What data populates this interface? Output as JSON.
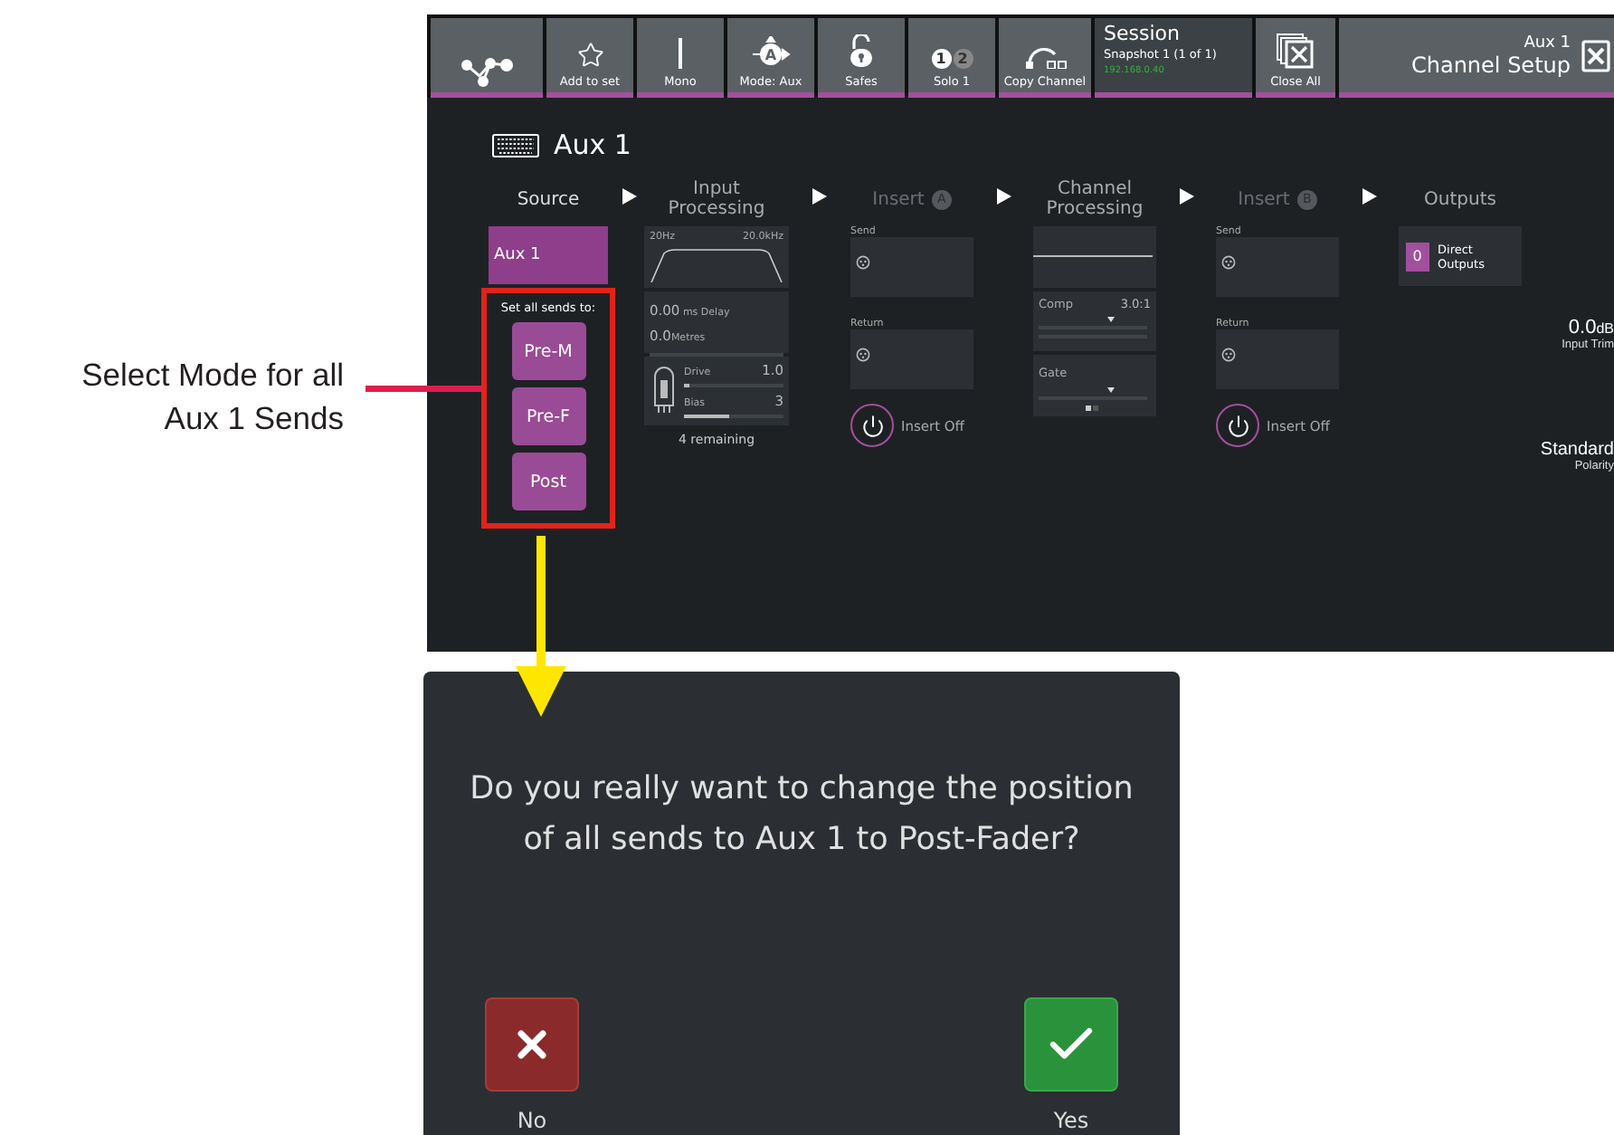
{
  "annotation": {
    "text": "Select Mode for all Aux 1 Sends"
  },
  "toolbar": {
    "buttons": [
      {
        "kind": "routing"
      },
      {
        "kind": "star",
        "label": "Add to set"
      },
      {
        "kind": "mono",
        "label": "Mono"
      },
      {
        "kind": "mode",
        "label": "Mode: Aux",
        "icon_text": "A"
      },
      {
        "kind": "lock",
        "label": "Safes"
      },
      {
        "kind": "solo",
        "label": "Solo 1",
        "solo_marks": [
          {
            "text": "1",
            "on": true
          },
          {
            "text": "2",
            "on": false
          }
        ]
      },
      {
        "kind": "copy",
        "label": "Copy Channel"
      }
    ],
    "session": {
      "title": "Session",
      "snapshot": "Snapshot 1 (1 of 1)",
      "address": "192.168.0.40"
    },
    "close_all": {
      "label": "Close All"
    },
    "header": {
      "subtitle": "Aux 1",
      "title": "Channel Setup"
    }
  },
  "channel": {
    "name": "Aux 1"
  },
  "stages": [
    {
      "kind": "source",
      "title": "Source",
      "source": "Aux 1",
      "sends_prompt": "Set all sends to:",
      "send_modes": [
        "Pre-M",
        "Pre-F",
        "Post"
      ]
    },
    {
      "kind": "input",
      "title": "Input Processing",
      "filter_low": "20Hz",
      "filter_high": "20.0kHz",
      "delay_value": "0.00",
      "delay_unit": "ms Delay",
      "distance_value": "0.0",
      "distance_unit": "Metres",
      "drive": {
        "label": "Drive",
        "value": "1.0",
        "level": 0.05
      },
      "bias": {
        "label": "Bias",
        "value": "3",
        "level": 0.45
      },
      "remaining": "4 remaining"
    },
    {
      "kind": "insert",
      "title": "Insert",
      "badge": "A",
      "enabled": false,
      "send_label": "Send",
      "return_label": "Return",
      "status": "Insert Off"
    },
    {
      "kind": "channel",
      "title": "Channel Processing",
      "comp_label": "Comp",
      "comp_value": "3.0:1",
      "gate_label": "Gate"
    },
    {
      "kind": "insert",
      "title": "Insert",
      "badge": "B",
      "enabled": false,
      "send_label": "Send",
      "return_label": "Return",
      "status": "Insert Off"
    },
    {
      "kind": "outputs",
      "title": "Outputs",
      "count": "0",
      "label": "Direct Outputs"
    }
  ],
  "trim": {
    "value": "0.0",
    "unit": "dB",
    "label": "Input Trim"
  },
  "polarity": {
    "value": "Standard",
    "label": "Polarity"
  },
  "dialog": {
    "message": "Do you really want to change the position of all sends to Aux 1 to Post-Fader?",
    "buttons": [
      {
        "kind": "cancel",
        "label": "No"
      },
      {
        "kind": "confirm",
        "label": "Yes"
      }
    ]
  }
}
